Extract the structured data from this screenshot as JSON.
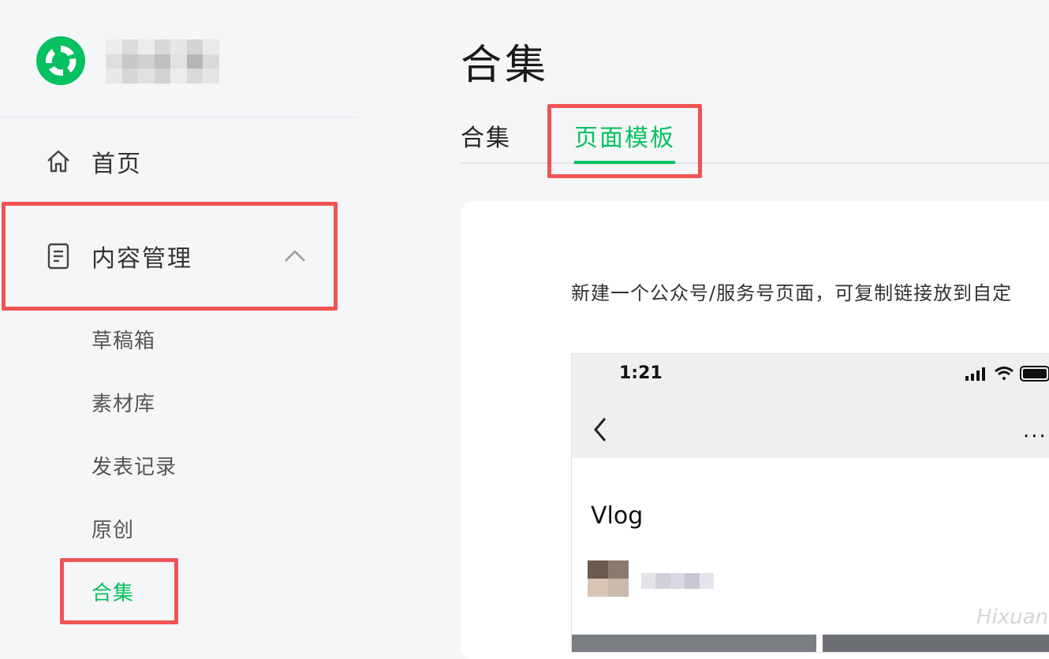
{
  "colors": {
    "accent": "#07c160",
    "highlight_box": "#f05454",
    "sidebar_bg": "#f5f6f8"
  },
  "sidebar": {
    "logo_icon": "wechat-official-account-logo",
    "account_name_blurred": true,
    "nav": {
      "home": {
        "label": "首页",
        "icon": "home-icon"
      },
      "content": {
        "label": "内容管理",
        "icon": "document-icon",
        "expanded": true
      },
      "sub_items": [
        {
          "label": "草稿箱"
        },
        {
          "label": "素材库"
        },
        {
          "label": "发表记录"
        },
        {
          "label": "原创"
        },
        {
          "label": "合集",
          "active": true
        }
      ]
    }
  },
  "main": {
    "title": "合集",
    "tabs": [
      {
        "label": "合集",
        "active": false
      },
      {
        "label": "页面模板",
        "active": true
      }
    ],
    "card": {
      "description": "新建一个公众号/服务号页面，可复制链接放到自定",
      "phone_preview": {
        "time": "1:21",
        "back_icon": "chevron-left-icon",
        "more_label": "···",
        "title": "Vlog"
      }
    }
  },
  "watermark": "Hixuan"
}
